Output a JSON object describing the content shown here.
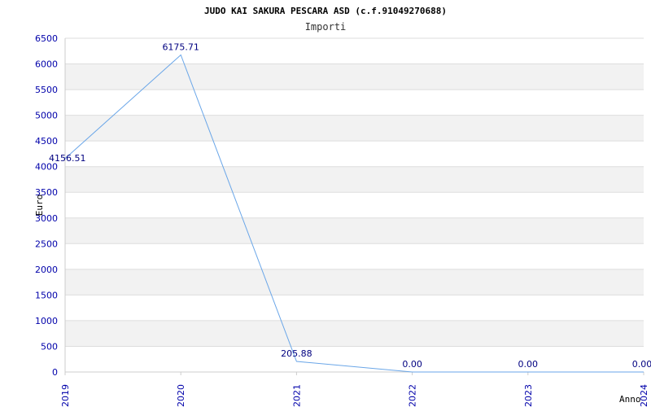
{
  "chart_data": {
    "type": "line",
    "title": "JUDO KAI SAKURA PESCARA ASD (c.f.91049270688)",
    "subtitle": "Importi",
    "xlabel": "Anno",
    "ylabel": "Euro",
    "x": [
      "2019",
      "2020",
      "2021",
      "2022",
      "2023",
      "2024"
    ],
    "values": [
      4156.51,
      6175.71,
      205.88,
      0.0,
      0.0,
      0.0
    ],
    "data_labels": [
      "4156.51",
      "6175.71",
      "205.88",
      "0.00",
      "0.00",
      "0.00"
    ],
    "ylim": [
      0,
      6500
    ],
    "yticks": [
      0,
      500,
      1000,
      1500,
      2000,
      2500,
      3000,
      3500,
      4000,
      4500,
      5000,
      5500,
      6000,
      6500
    ],
    "grid": true,
    "colors": {
      "line": "#6aa6e8",
      "band": "#f2f2f2",
      "gridline": "#dddddd",
      "tick_text": "#0000aa",
      "label_text": "#000080",
      "title_text": "#000000"
    }
  }
}
